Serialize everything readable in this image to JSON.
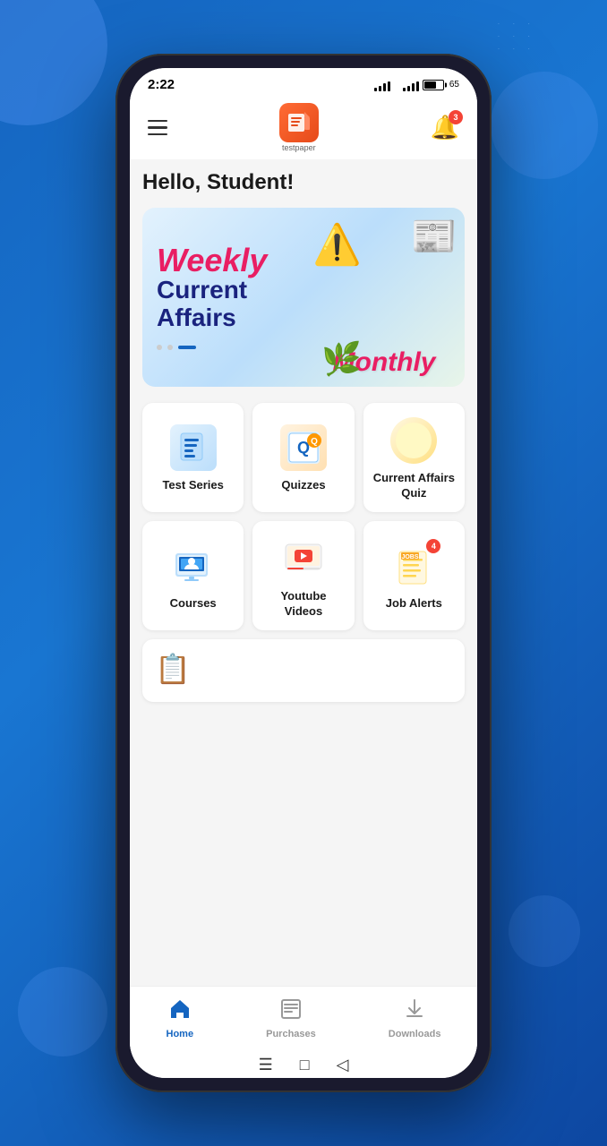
{
  "background": {
    "color": "#1565c0"
  },
  "status_bar": {
    "time": "2:22",
    "battery_percent": "65"
  },
  "header": {
    "menu_label": "Menu",
    "logo_text": "testpaper",
    "notification_badge": "3"
  },
  "greeting": "Hello, Student!",
  "banner": {
    "line1": "Weekly",
    "line2": "Current",
    "line3": "Affairs",
    "monthly_label": "Monthly",
    "dots": [
      {
        "active": false
      },
      {
        "active": true
      },
      {
        "active": false
      }
    ]
  },
  "grid": {
    "cards": [
      {
        "id": "test-series",
        "label": "Test Series",
        "icon": "📋"
      },
      {
        "id": "quizzes",
        "label": "Quizzes",
        "icon": "🧩"
      },
      {
        "id": "current-affairs-quiz",
        "label": "Current Affairs Quiz",
        "icon": "🌍"
      },
      {
        "id": "courses",
        "label": "Courses",
        "icon": "💻"
      },
      {
        "id": "youtube-videos",
        "label": "Youtube Videos",
        "icon": "▶️"
      },
      {
        "id": "job-alerts",
        "label": "Job Alerts",
        "icon": "📄",
        "badge": "4"
      }
    ]
  },
  "bottom_nav": {
    "items": [
      {
        "id": "home",
        "label": "Home",
        "icon": "🏠",
        "active": true
      },
      {
        "id": "purchases",
        "label": "Purchases",
        "icon": "🛒",
        "active": false
      },
      {
        "id": "downloads",
        "label": "Downloads",
        "icon": "⬇",
        "active": false
      }
    ]
  },
  "gesture_bar": {
    "icons": [
      "☰",
      "□",
      "◁"
    ]
  }
}
